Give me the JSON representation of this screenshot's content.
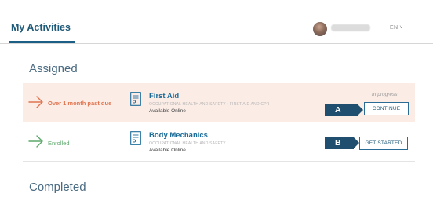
{
  "header": {
    "tab_label": "My Activities",
    "user_name": "",
    "language": "EN",
    "language_chevron": "˅"
  },
  "sections": {
    "assigned_title": "Assigned",
    "completed_title": "Completed"
  },
  "assigned": [
    {
      "status": "Over 1 month past due",
      "status_color": "#e0744e",
      "title": "First Aid",
      "path": "OCCUPATIONAL HEALTH AND SAFETY › FIRST AID AND CPR",
      "availability": "Available Online",
      "progress": "In progress",
      "button_label": "CONTINUE",
      "marker": "A",
      "highlight_bg": "#fbece6"
    },
    {
      "status": "Enrolled",
      "status_color": "#5ba86a",
      "title": "Body Mechanics",
      "path": "OCCUPATIONAL HEALTH AND SAFETY",
      "availability": "Available Online",
      "progress": "",
      "button_label": "GET STARTED",
      "marker": "B",
      "highlight_bg": "#ffffff"
    }
  ],
  "colors": {
    "accent": "#1b5f86",
    "marker_bg": "#1f4e6f"
  },
  "icons": {
    "arrow": "arrow-right-icon",
    "course": "document-icon"
  }
}
